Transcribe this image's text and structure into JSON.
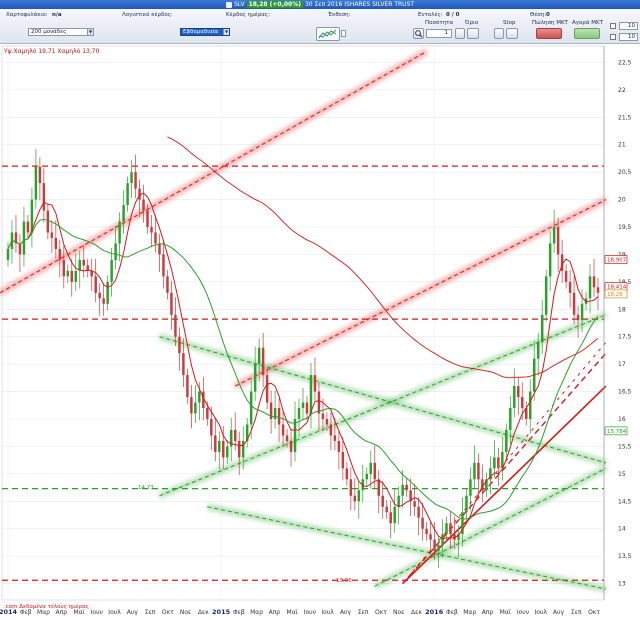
{
  "titlebar": {
    "symbol": "SLV",
    "price_badge": "18,28 (+0,00%)",
    "date_name": "30 Σεπ 2016 ISHARES SILVER TRUST"
  },
  "toolbar": {
    "portfolio_label": "Χαρτοφυλάκιο:",
    "portfolio_value": "n/a",
    "accounting_profit_label": "Λογιστικό κέρδος:",
    "daily_profit_label": "Κέρδος ημέρας:",
    "exposure_label": "Έκθεση:",
    "orders_label": "Εντολές:",
    "orders_value": "0 / 0",
    "position_label": "Θέση:",
    "position_value": "0",
    "units_select": "200 μονάδες",
    "timeframe_select": "Εβδομαδιαία",
    "qty_label": "Ποσότητα",
    "limit_label": "Όριο",
    "stop_label": "Stop",
    "sell_mkt_label": "Πώληση ΜΚΤ",
    "buy_mkt_label": "Αγορά ΜΚΤ",
    "qty_value": "1",
    "spin1_value": "10",
    "spin2_value": "10",
    "search_icon": "magnifier-icon",
    "chart_icon": "chart-type-icon"
  },
  "chart_annotations": {
    "high_low_text": "Υψ.Χαμηλό 19,71 Χαμηλό 13,70",
    "level_1473": "14,73",
    "level_1306": "13,06",
    "footer_link": ".com  Δεδομένα τέλους ημέρας"
  },
  "chart_data": {
    "type": "candlestick",
    "title": "",
    "xlabel": "",
    "ylabel": "",
    "ylim": [
      12.7,
      22.8
    ],
    "y_ticks": [
      13,
      13.5,
      14,
      14.5,
      15,
      15.5,
      16,
      16.5,
      17,
      17.5,
      18,
      18.5,
      19,
      19.5,
      20,
      20.5,
      21,
      21.5,
      22,
      22.5
    ],
    "y_tick_labels": [
      "13",
      "13,5",
      "14",
      "14,5",
      "15",
      "15,5",
      "16",
      "16,5",
      "17",
      "17,5",
      "18",
      "18,5",
      "19",
      "19,5",
      "20",
      "20,5",
      "21",
      "21,5",
      "22",
      "22,5"
    ],
    "x_tick_labels": [
      {
        "label": "2014",
        "year": true
      },
      {
        "label": "Φεβ"
      },
      {
        "label": "Μαρ"
      },
      {
        "label": "Απρ"
      },
      {
        "label": "Μαϊ"
      },
      {
        "label": "Ιουν"
      },
      {
        "label": "Ιουλ"
      },
      {
        "label": "Αυγ"
      },
      {
        "label": "Σεπ"
      },
      {
        "label": "Οκτ"
      },
      {
        "label": "Νοε"
      },
      {
        "label": "Δεκ"
      },
      {
        "label": "2015",
        "year": true
      },
      {
        "label": "Φεβ"
      },
      {
        "label": "Μαρ"
      },
      {
        "label": "Απρ"
      },
      {
        "label": "Μαϊ"
      },
      {
        "label": "Ιουν"
      },
      {
        "label": "Ιουλ"
      },
      {
        "label": "Αυγ"
      },
      {
        "label": "Σεπ"
      },
      {
        "label": "Οκτ"
      },
      {
        "label": "Νοε"
      },
      {
        "label": "Δεκ"
      },
      {
        "label": "2016",
        "year": true
      },
      {
        "label": "Φεβ"
      },
      {
        "label": "Μαρ"
      },
      {
        "label": "Απρ"
      },
      {
        "label": "Μαϊ"
      },
      {
        "label": "Ιουν"
      },
      {
        "label": "Ιουλ"
      },
      {
        "label": "Αυγ"
      },
      {
        "label": "Σεπ"
      },
      {
        "label": "Οκτ"
      }
    ],
    "closes": [
      19.1,
      19.4,
      19.2,
      19.0,
      19.6,
      19.4,
      20.0,
      20.6,
      20.3,
      19.8,
      19.4,
      19.3,
      19.1,
      18.9,
      18.6,
      18.7,
      18.5,
      18.7,
      18.9,
      18.8,
      18.7,
      18.6,
      18.3,
      18.2,
      18.1,
      18.5,
      18.9,
      19.2,
      19.6,
      19.9,
      20.3,
      20.5,
      20.2,
      20.0,
      19.8,
      19.5,
      19.4,
      19.2,
      19.0,
      18.6,
      18.3,
      17.9,
      17.5,
      17.2,
      16.8,
      16.4,
      16.1,
      16.3,
      16.5,
      16.2,
      16.0,
      15.7,
      15.4,
      15.6,
      15.3,
      15.5,
      15.8,
      15.6,
      15.3,
      15.6,
      15.9,
      16.5,
      17.0,
      17.3,
      16.8,
      16.3,
      16.0,
      16.2,
      15.9,
      15.7,
      15.6,
      15.4,
      16.0,
      16.2,
      16.3,
      16.1,
      16.8,
      16.5,
      16.1,
      16.0,
      15.9,
      15.7,
      15.6,
      15.4,
      15.1,
      14.9,
      14.6,
      14.5,
      14.7,
      14.9,
      15.0,
      15.2,
      14.9,
      14.6,
      14.4,
      14.3,
      14.1,
      14.4,
      14.6,
      14.8,
      14.7,
      14.5,
      14.4,
      14.2,
      14.0,
      13.9,
      13.8,
      13.6,
      13.7,
      13.9,
      14.1,
      13.9,
      13.8,
      13.9,
      14.3,
      14.6,
      14.9,
      15.2,
      14.9,
      14.7,
      14.9,
      15.1,
      15.3,
      15.1,
      15.4,
      15.8,
      16.2,
      16.6,
      16.4,
      16.2,
      16.0,
      16.5,
      17.1,
      17.4,
      17.9,
      18.6,
      19.2,
      19.5,
      19.0,
      18.7,
      18.5,
      18.3,
      17.9,
      17.8,
      18.1,
      18.2,
      18.6,
      18.4,
      18.3
    ],
    "moving_averages": [
      {
        "color": "#d81818"
      },
      {
        "color": "#2aa02a"
      }
    ],
    "horizontal_levels": [
      {
        "value": 20.61,
        "color": "#d81818",
        "dash": true
      },
      {
        "value": 17.82,
        "color": "#d81818",
        "dash": true
      },
      {
        "value": 14.73,
        "color": "#2aa02a",
        "dash": true
      },
      {
        "value": 13.06,
        "color": "#d81818",
        "dash": true
      }
    ],
    "price_tags": [
      {
        "value": 18.907,
        "label": "18,907",
        "color": "#d81818"
      },
      {
        "value": 18.414,
        "label": "18,414",
        "color": "#d81818"
      },
      {
        "value": 18.28,
        "label": "18,28",
        "color": "#e08a10"
      },
      {
        "value": 15.784,
        "label": "15,784",
        "color": "#2aa02a"
      }
    ],
    "colors": {
      "up": "#2ca02c",
      "down": "#c83c3c",
      "red": "#d81818",
      "green": "#2aa02a"
    }
  }
}
